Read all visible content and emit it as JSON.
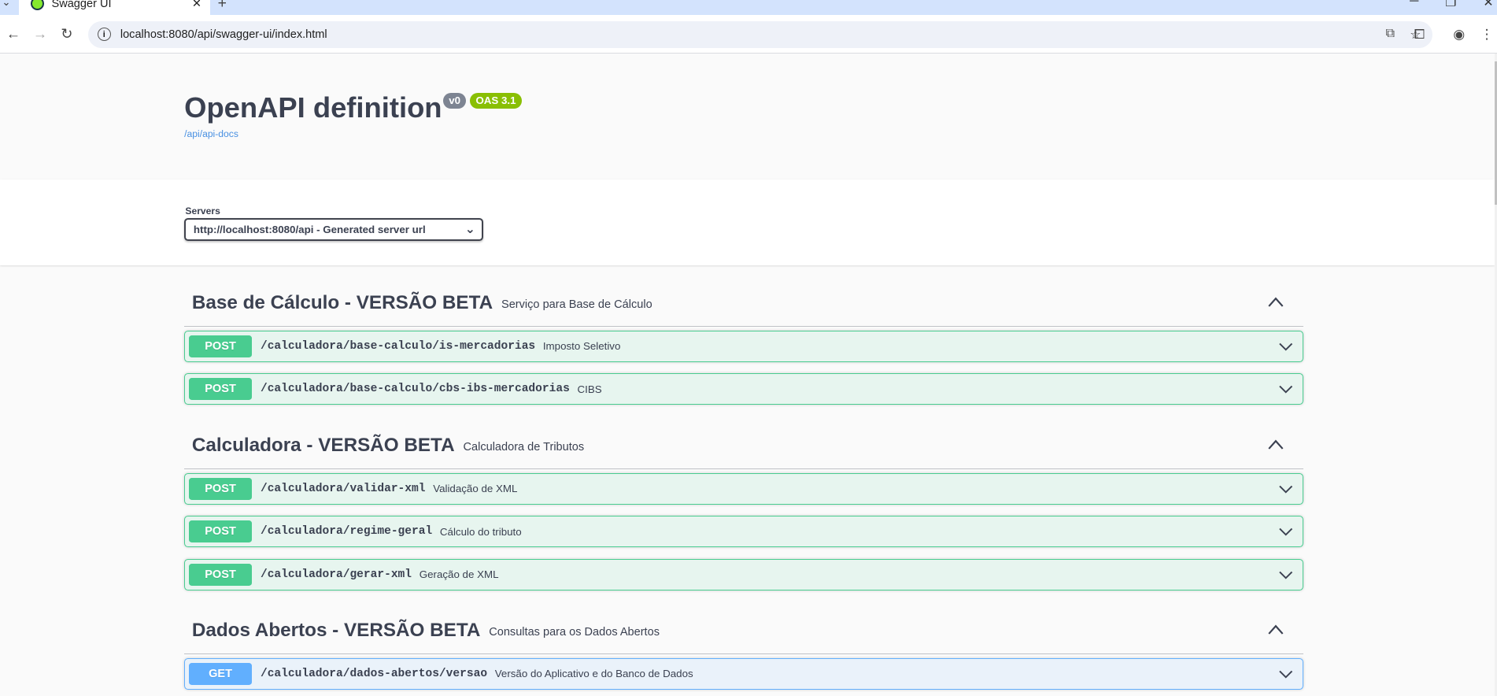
{
  "browser": {
    "tab_title": "Swagger UI",
    "url": "localhost:8080/api/swagger-ui/index.html"
  },
  "info": {
    "title": "OpenAPI definition",
    "version_badge": "v0",
    "oas_badge": "OAS 3.1",
    "spec_link": "/api/api-docs"
  },
  "servers": {
    "label": "Servers",
    "selected": "http://localhost:8080/api - Generated server url"
  },
  "tags": [
    {
      "name": "Base de Cálculo - VERSÃO BETA",
      "description": "Serviço para Base de Cálculo",
      "operations": [
        {
          "method": "POST",
          "path": "/calculadora/base-calculo/is-mercadorias",
          "summary": "Imposto Seletivo"
        },
        {
          "method": "POST",
          "path": "/calculadora/base-calculo/cbs-ibs-mercadorias",
          "summary": "CIBS"
        }
      ]
    },
    {
      "name": "Calculadora - VERSÃO BETA",
      "description": "Calculadora de Tributos",
      "operations": [
        {
          "method": "POST",
          "path": "/calculadora/validar-xml",
          "summary": "Validação de XML"
        },
        {
          "method": "POST",
          "path": "/calculadora/regime-geral",
          "summary": "Cálculo do tributo"
        },
        {
          "method": "POST",
          "path": "/calculadora/gerar-xml",
          "summary": "Geração de XML"
        }
      ]
    },
    {
      "name": "Dados Abertos - VERSÃO BETA",
      "description": "Consultas para os Dados Abertos",
      "operations": [
        {
          "method": "GET",
          "path": "/calculadora/dados-abertos/versao",
          "summary": "Versão do Aplicativo e do Banco de Dados"
        }
      ]
    }
  ],
  "colors": {
    "post": "#49cc90",
    "get": "#61affe",
    "version_badge": "#7d8492",
    "oas_badge": "#89bf04"
  },
  "icons": [
    "back-arrow-icon",
    "forward-arrow-icon",
    "reload-icon",
    "site-info-icon",
    "translate-icon",
    "bookmark-star-icon",
    "extensions-icon",
    "profile-icon",
    "menu-kebab-icon",
    "chevron-up-icon",
    "chevron-down-icon"
  ]
}
